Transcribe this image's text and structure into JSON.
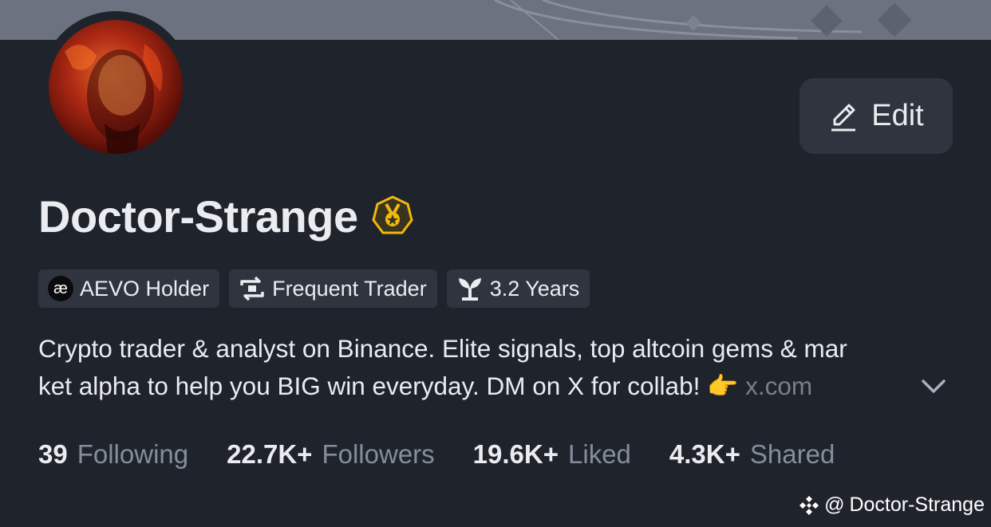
{
  "profile": {
    "name": "Doctor-Strange",
    "edit_label": "Edit",
    "badges": [
      {
        "icon": "aevo-logo-icon",
        "label": "AEVO Holder",
        "glyph": "æ"
      },
      {
        "icon": "repeat-icon",
        "label": "Frequent Trader"
      },
      {
        "icon": "sprout-icon",
        "label": "3.2 Years"
      }
    ],
    "bio_line1": "Crypto trader & analyst on Binance. Elite signals, top altcoin gems & mar",
    "bio_line2": "ket alpha to help you BIG win everyday. DM on X for collab! ",
    "bio_emoji": "👉",
    "bio_link": "x.com"
  },
  "stats": [
    {
      "value": "39",
      "label": "Following"
    },
    {
      "value": "22.7K+",
      "label": "Followers"
    },
    {
      "value": "19.6K+",
      "label": "Liked"
    },
    {
      "value": "4.3K+",
      "label": "Shared"
    }
  ],
  "watermark": {
    "at": "@",
    "handle": "Doctor-Strange"
  },
  "colors": {
    "background": "#1f232c",
    "surface": "#2f343e",
    "muted_text": "#848e9c",
    "badge_gold": "#f0b90b"
  }
}
